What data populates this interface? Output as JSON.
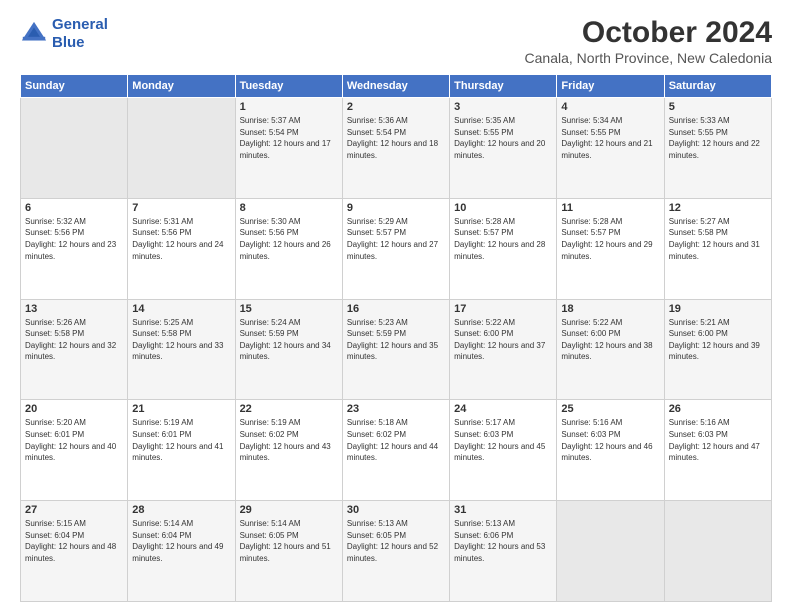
{
  "header": {
    "logo_line1": "General",
    "logo_line2": "Blue",
    "month": "October 2024",
    "location": "Canala, North Province, New Caledonia"
  },
  "weekdays": [
    "Sunday",
    "Monday",
    "Tuesday",
    "Wednesday",
    "Thursday",
    "Friday",
    "Saturday"
  ],
  "weeks": [
    [
      {
        "day": "",
        "sunrise": "",
        "sunset": "",
        "daylight": ""
      },
      {
        "day": "",
        "sunrise": "",
        "sunset": "",
        "daylight": ""
      },
      {
        "day": "1",
        "sunrise": "Sunrise: 5:37 AM",
        "sunset": "Sunset: 5:54 PM",
        "daylight": "Daylight: 12 hours and 17 minutes."
      },
      {
        "day": "2",
        "sunrise": "Sunrise: 5:36 AM",
        "sunset": "Sunset: 5:54 PM",
        "daylight": "Daylight: 12 hours and 18 minutes."
      },
      {
        "day": "3",
        "sunrise": "Sunrise: 5:35 AM",
        "sunset": "Sunset: 5:55 PM",
        "daylight": "Daylight: 12 hours and 20 minutes."
      },
      {
        "day": "4",
        "sunrise": "Sunrise: 5:34 AM",
        "sunset": "Sunset: 5:55 PM",
        "daylight": "Daylight: 12 hours and 21 minutes."
      },
      {
        "day": "5",
        "sunrise": "Sunrise: 5:33 AM",
        "sunset": "Sunset: 5:55 PM",
        "daylight": "Daylight: 12 hours and 22 minutes."
      }
    ],
    [
      {
        "day": "6",
        "sunrise": "Sunrise: 5:32 AM",
        "sunset": "Sunset: 5:56 PM",
        "daylight": "Daylight: 12 hours and 23 minutes."
      },
      {
        "day": "7",
        "sunrise": "Sunrise: 5:31 AM",
        "sunset": "Sunset: 5:56 PM",
        "daylight": "Daylight: 12 hours and 24 minutes."
      },
      {
        "day": "8",
        "sunrise": "Sunrise: 5:30 AM",
        "sunset": "Sunset: 5:56 PM",
        "daylight": "Daylight: 12 hours and 26 minutes."
      },
      {
        "day": "9",
        "sunrise": "Sunrise: 5:29 AM",
        "sunset": "Sunset: 5:57 PM",
        "daylight": "Daylight: 12 hours and 27 minutes."
      },
      {
        "day": "10",
        "sunrise": "Sunrise: 5:28 AM",
        "sunset": "Sunset: 5:57 PM",
        "daylight": "Daylight: 12 hours and 28 minutes."
      },
      {
        "day": "11",
        "sunrise": "Sunrise: 5:28 AM",
        "sunset": "Sunset: 5:57 PM",
        "daylight": "Daylight: 12 hours and 29 minutes."
      },
      {
        "day": "12",
        "sunrise": "Sunrise: 5:27 AM",
        "sunset": "Sunset: 5:58 PM",
        "daylight": "Daylight: 12 hours and 31 minutes."
      }
    ],
    [
      {
        "day": "13",
        "sunrise": "Sunrise: 5:26 AM",
        "sunset": "Sunset: 5:58 PM",
        "daylight": "Daylight: 12 hours and 32 minutes."
      },
      {
        "day": "14",
        "sunrise": "Sunrise: 5:25 AM",
        "sunset": "Sunset: 5:58 PM",
        "daylight": "Daylight: 12 hours and 33 minutes."
      },
      {
        "day": "15",
        "sunrise": "Sunrise: 5:24 AM",
        "sunset": "Sunset: 5:59 PM",
        "daylight": "Daylight: 12 hours and 34 minutes."
      },
      {
        "day": "16",
        "sunrise": "Sunrise: 5:23 AM",
        "sunset": "Sunset: 5:59 PM",
        "daylight": "Daylight: 12 hours and 35 minutes."
      },
      {
        "day": "17",
        "sunrise": "Sunrise: 5:22 AM",
        "sunset": "Sunset: 6:00 PM",
        "daylight": "Daylight: 12 hours and 37 minutes."
      },
      {
        "day": "18",
        "sunrise": "Sunrise: 5:22 AM",
        "sunset": "Sunset: 6:00 PM",
        "daylight": "Daylight: 12 hours and 38 minutes."
      },
      {
        "day": "19",
        "sunrise": "Sunrise: 5:21 AM",
        "sunset": "Sunset: 6:00 PM",
        "daylight": "Daylight: 12 hours and 39 minutes."
      }
    ],
    [
      {
        "day": "20",
        "sunrise": "Sunrise: 5:20 AM",
        "sunset": "Sunset: 6:01 PM",
        "daylight": "Daylight: 12 hours and 40 minutes."
      },
      {
        "day": "21",
        "sunrise": "Sunrise: 5:19 AM",
        "sunset": "Sunset: 6:01 PM",
        "daylight": "Daylight: 12 hours and 41 minutes."
      },
      {
        "day": "22",
        "sunrise": "Sunrise: 5:19 AM",
        "sunset": "Sunset: 6:02 PM",
        "daylight": "Daylight: 12 hours and 43 minutes."
      },
      {
        "day": "23",
        "sunrise": "Sunrise: 5:18 AM",
        "sunset": "Sunset: 6:02 PM",
        "daylight": "Daylight: 12 hours and 44 minutes."
      },
      {
        "day": "24",
        "sunrise": "Sunrise: 5:17 AM",
        "sunset": "Sunset: 6:03 PM",
        "daylight": "Daylight: 12 hours and 45 minutes."
      },
      {
        "day": "25",
        "sunrise": "Sunrise: 5:16 AM",
        "sunset": "Sunset: 6:03 PM",
        "daylight": "Daylight: 12 hours and 46 minutes."
      },
      {
        "day": "26",
        "sunrise": "Sunrise: 5:16 AM",
        "sunset": "Sunset: 6:03 PM",
        "daylight": "Daylight: 12 hours and 47 minutes."
      }
    ],
    [
      {
        "day": "27",
        "sunrise": "Sunrise: 5:15 AM",
        "sunset": "Sunset: 6:04 PM",
        "daylight": "Daylight: 12 hours and 48 minutes."
      },
      {
        "day": "28",
        "sunrise": "Sunrise: 5:14 AM",
        "sunset": "Sunset: 6:04 PM",
        "daylight": "Daylight: 12 hours and 49 minutes."
      },
      {
        "day": "29",
        "sunrise": "Sunrise: 5:14 AM",
        "sunset": "Sunset: 6:05 PM",
        "daylight": "Daylight: 12 hours and 51 minutes."
      },
      {
        "day": "30",
        "sunrise": "Sunrise: 5:13 AM",
        "sunset": "Sunset: 6:05 PM",
        "daylight": "Daylight: 12 hours and 52 minutes."
      },
      {
        "day": "31",
        "sunrise": "Sunrise: 5:13 AM",
        "sunset": "Sunset: 6:06 PM",
        "daylight": "Daylight: 12 hours and 53 minutes."
      },
      {
        "day": "",
        "sunrise": "",
        "sunset": "",
        "daylight": ""
      },
      {
        "day": "",
        "sunrise": "",
        "sunset": "",
        "daylight": ""
      }
    ]
  ]
}
